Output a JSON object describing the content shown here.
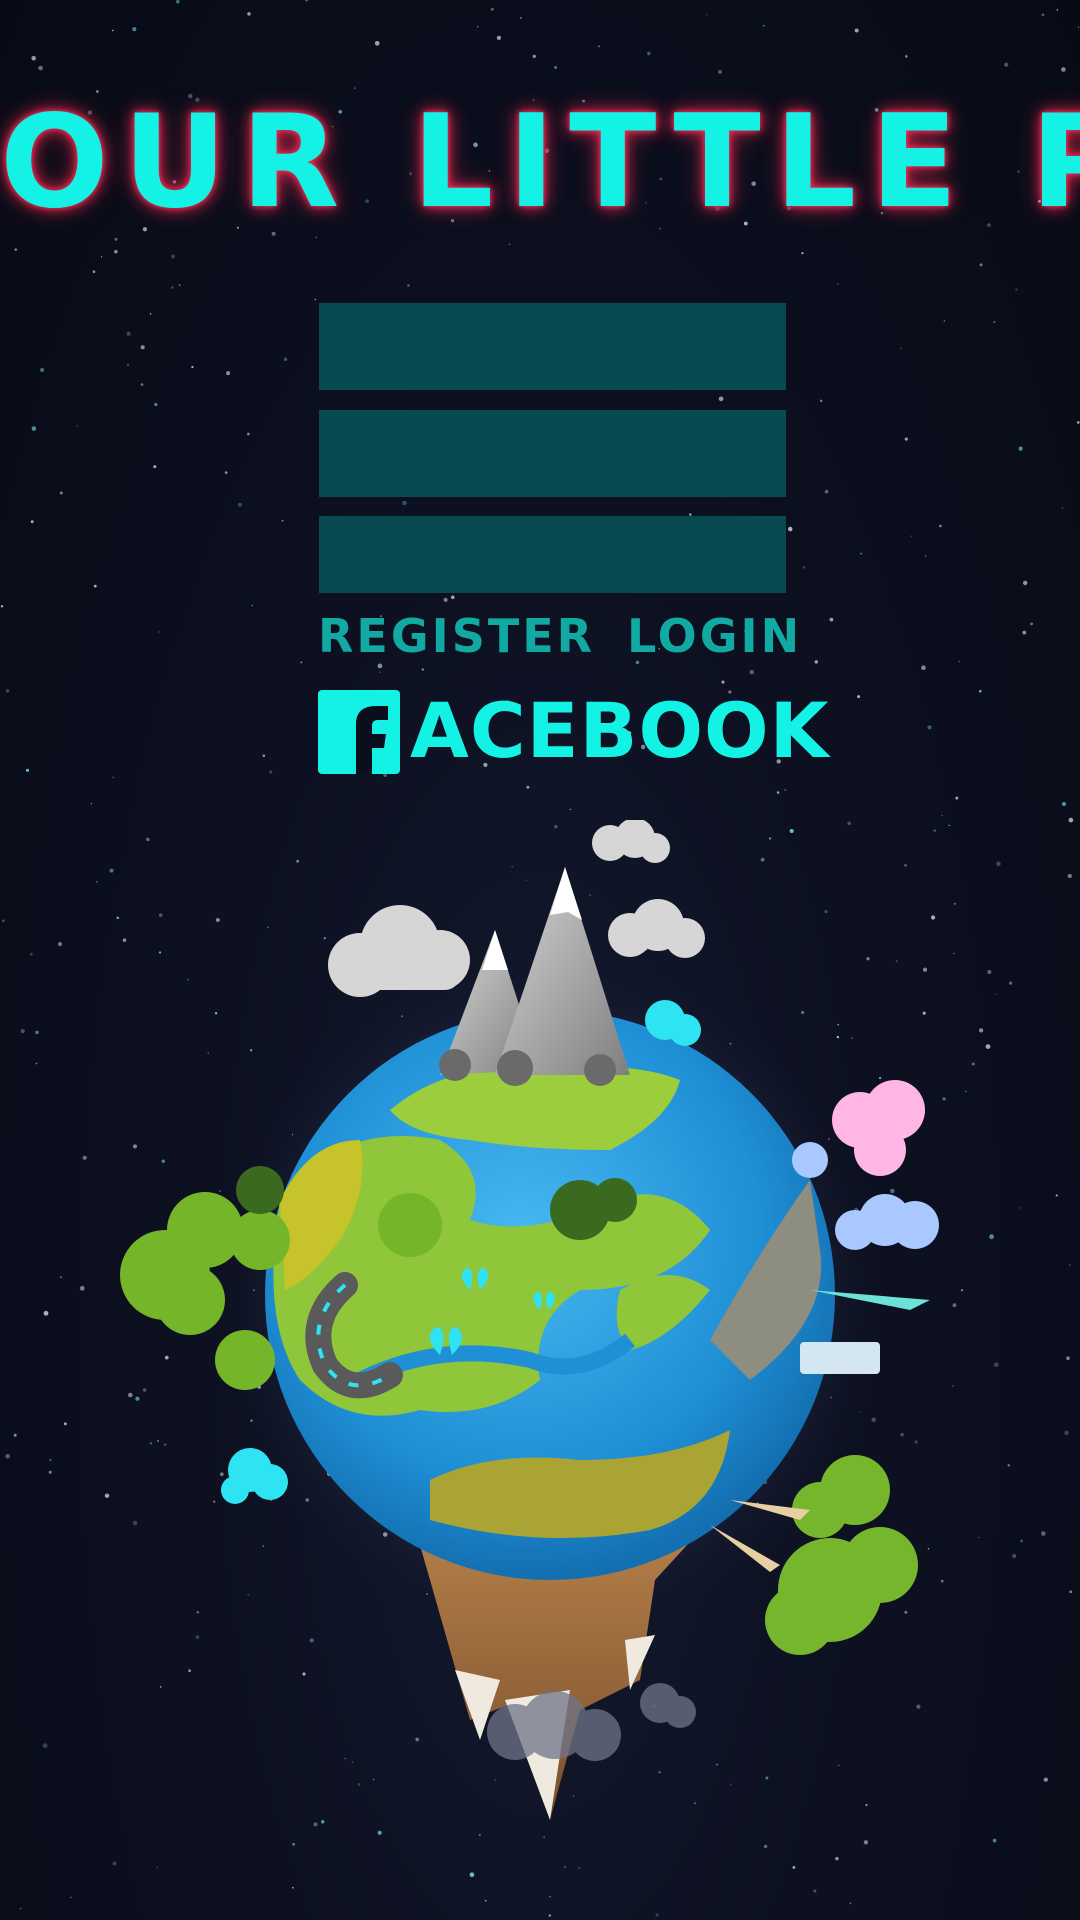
{
  "title": "OUR LITTLE PLANET",
  "form": {
    "fields": [
      {
        "value": "",
        "placeholder": ""
      },
      {
        "value": "",
        "placeholder": ""
      },
      {
        "value": "",
        "placeholder": ""
      }
    ],
    "register_label": "REGISTER",
    "login_label": "LOGIN",
    "facebook_label": "ACEBOOK",
    "facebook_icon": "facebook-f-icon"
  },
  "illustration": "planet-illustration",
  "colors": {
    "background": "#0b0e1c",
    "title": "#14f2e6",
    "title_glow": "#ff2d55",
    "field": "#084a52",
    "link": "#12a9a2",
    "facebook": "#14f2e6"
  }
}
